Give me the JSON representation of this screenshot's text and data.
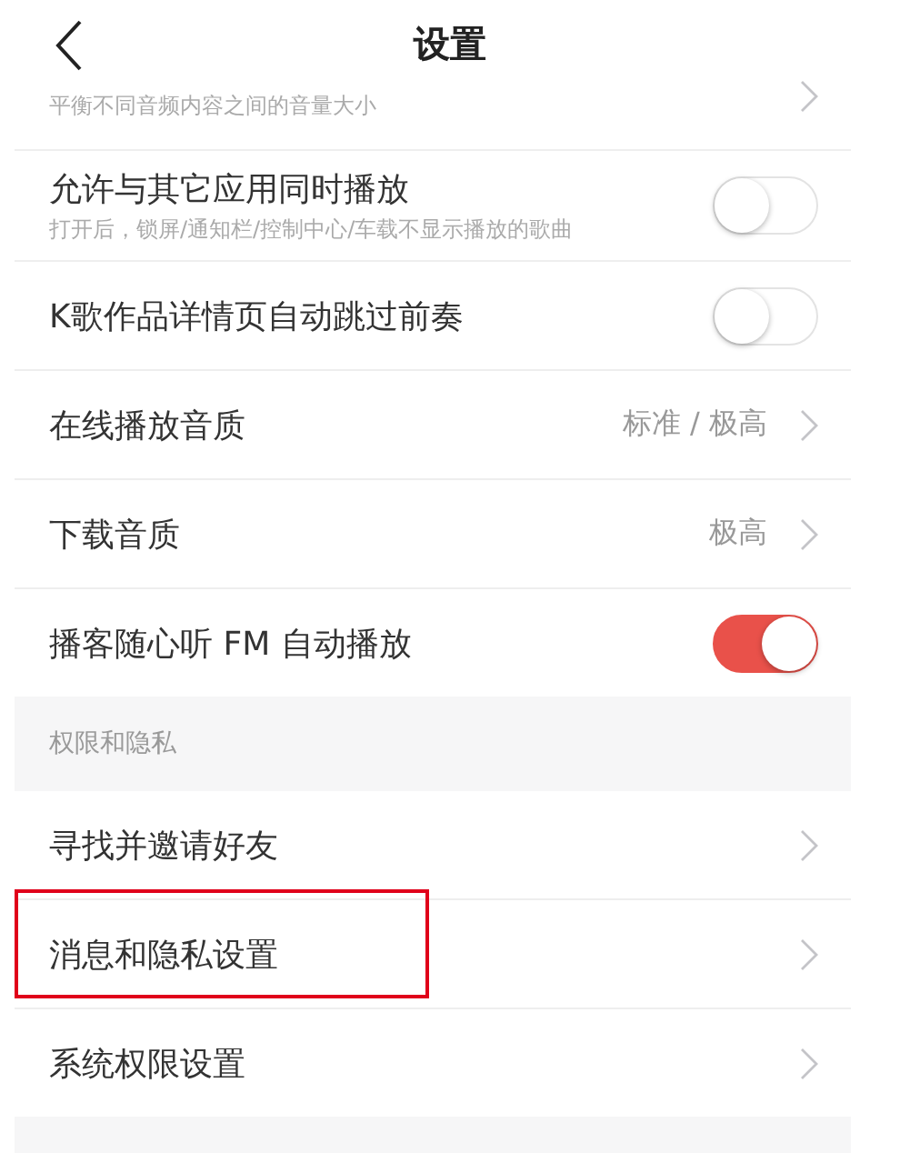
{
  "header": {
    "title": "设置"
  },
  "sections": [
    {
      "items": [
        {
          "kind": "link",
          "subtitle": "平衡不同音频内容之间的音量大小",
          "partial": true
        },
        {
          "kind": "toggle",
          "label": "允许与其它应用同时播放",
          "subtitle": "打开后，锁屏/通知栏/控制中心/车载不显示播放的歌曲",
          "on": false
        },
        {
          "kind": "toggle",
          "label": "K歌作品详情页自动跳过前奏",
          "on": false
        },
        {
          "kind": "link",
          "label": "在线播放音质",
          "value": "标准 / 极高"
        },
        {
          "kind": "link",
          "label": "下载音质",
          "value": "极高"
        },
        {
          "kind": "toggle",
          "label": "播客随心听 FM 自动播放",
          "on": true
        }
      ]
    },
    {
      "heading": "权限和隐私",
      "items": [
        {
          "kind": "link",
          "label": "寻找并邀请好友",
          "highlighted": false
        },
        {
          "kind": "link",
          "label": "消息和隐私设置",
          "highlighted": true
        },
        {
          "kind": "link",
          "label": "系统权限设置",
          "highlighted": false
        }
      ]
    }
  ]
}
